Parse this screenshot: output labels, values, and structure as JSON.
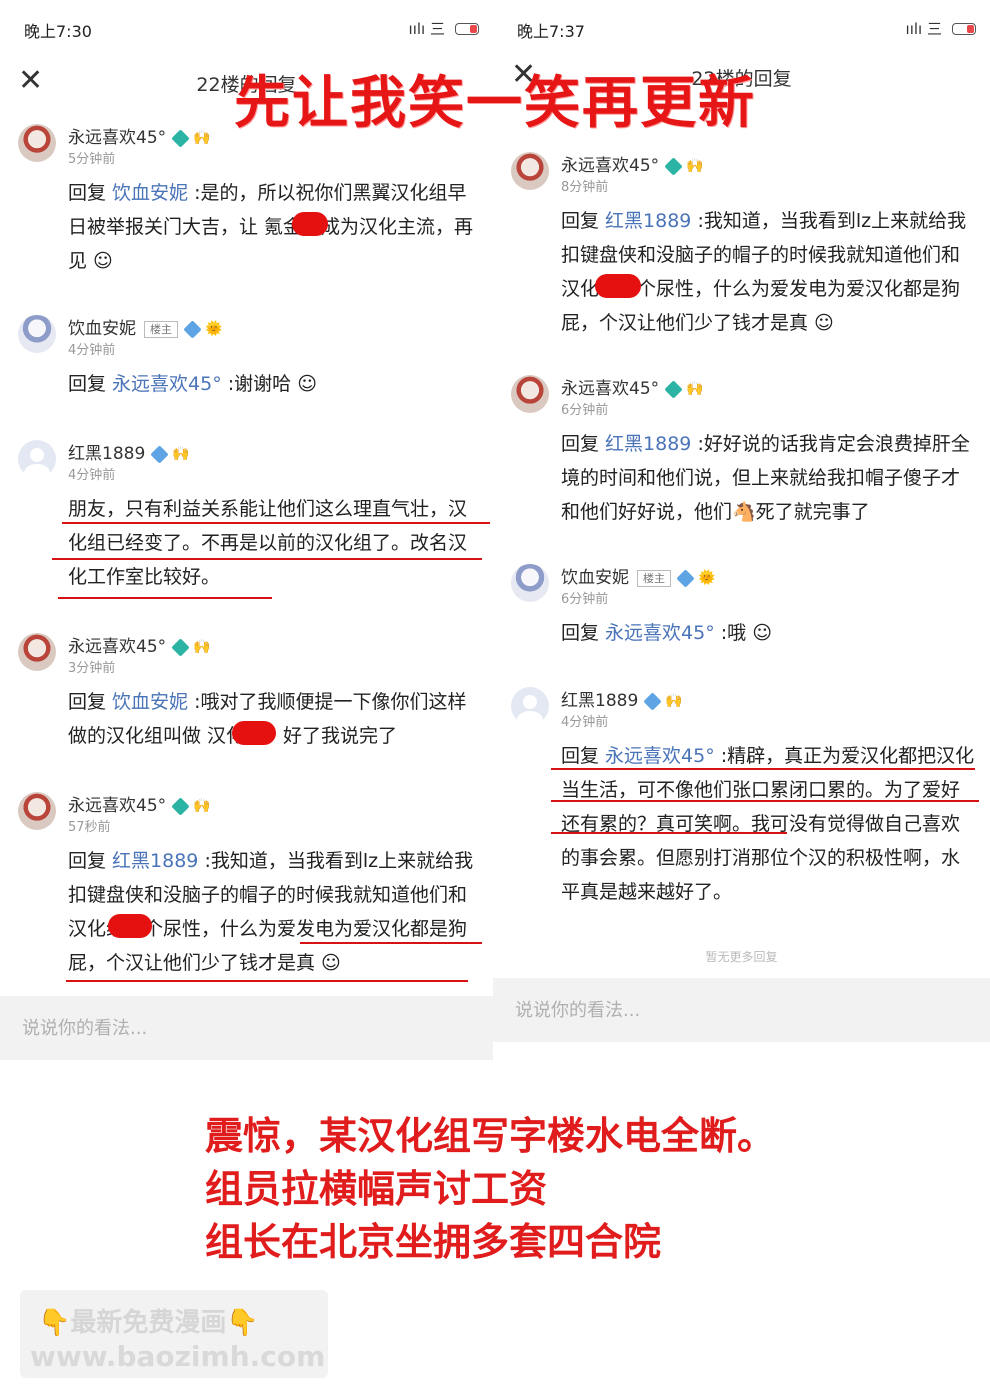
{
  "left": {
    "status_time": "晚上7:30",
    "status_icons": "ıılı 三",
    "title": "22楼的回复",
    "comments": [
      {
        "name": "永远喜欢45°",
        "time": "5分钟前",
        "prefix": "回复 ",
        "mention": "饮血安妮",
        "body": " :是的，所以祝你们黑翼汉化组早日被举报关门大吉，让      氪金屋成为汉化主流，再见 ☺"
      },
      {
        "name": "饮血安妮",
        "badge": "楼主",
        "time": "4分钟前",
        "prefix": "回复 ",
        "mention": "永远喜欢45°",
        "body": " :谢谢哈 ☺"
      },
      {
        "name": "红黑1889",
        "time": "4分钟前",
        "prefix": "",
        "mention": "",
        "body": "朋友，只有利益关系能让他们这么理直气壮，汉化组已经变了。不再是以前的汉化组了。改名汉化工作室比较好。"
      },
      {
        "name": "永远喜欢45°",
        "time": "3分钟前",
        "prefix": "回复 ",
        "mention": "饮血安妮",
        "body": " :哦对了我顺便提一下像你们这样做的汉化组叫做      汉化组，好了我说完了"
      },
      {
        "name": "永远喜欢45°",
        "time": "57秒前",
        "prefix": "回复 ",
        "mention": "红黑1889",
        "body": " :我知道，当我看到lz上来就给我扣键盘侠和没脑子的帽子的时候我就知道他们和      汉化组一个尿性，什么为爱发电为爱汉化都是狗屁，个汉让他们少了钱才是真 ☺"
      }
    ],
    "input_placeholder": "说说你的看法..."
  },
  "right": {
    "status_time": "晚上7:37",
    "status_icons": "ıılı 三",
    "title": "22楼的回复",
    "comments": [
      {
        "name": "永远喜欢45°",
        "time": "8分钟前",
        "prefix": "回复 ",
        "mention": "红黑1889",
        "body": " :我知道，当我看到lz上来就给我扣键盘侠和没脑子的帽子的时候我就知道他们和      汉化组一个尿性，什么为爱发电为爱汉化都是狗屁，个汉让他们少了钱才是真 ☺"
      },
      {
        "name": "永远喜欢45°",
        "time": "6分钟前",
        "prefix": "回复 ",
        "mention": "红黑1889",
        "body": " :好好说的话我肯定会浪费掉肝全境的时间和他们说，但上来就给我扣帽子傻子才和他们好好说，他们🐴死了就完事了"
      },
      {
        "name": "饮血安妮",
        "badge": "楼主",
        "time": "6分钟前",
        "prefix": "回复 ",
        "mention": "永远喜欢45°",
        "body": " :哦 ☺"
      },
      {
        "name": "红黑1889",
        "time": "4分钟前",
        "prefix": "回复 ",
        "mention": "永远喜欢45°",
        "body": " :精辟，真正为爱汉化都把汉化当生活，可不像他们张口累闭口累的。为了爱好还有累的？真可笑啊。我可没有觉得做自己喜欢的事会累。但愿别打消那位个汉的积极性啊，水平真是越来越好了。"
      }
    ],
    "no_more": "暂无更多回复",
    "input_placeholder": "说说你的看法..."
  },
  "overlay": {
    "headline": "先让我笑一笑再更新",
    "caption_lines": [
      "震惊，某汉化组写字楼水电全断。",
      "组员拉横幅声讨工资",
      "组长在北京坐拥多套四合院"
    ],
    "watermark_line1": "👇最新免费漫画👇",
    "watermark_line2": "www.baozimh.com"
  },
  "colors": {
    "annotation_red": "#e61616",
    "link_blue": "#4a74b8"
  }
}
